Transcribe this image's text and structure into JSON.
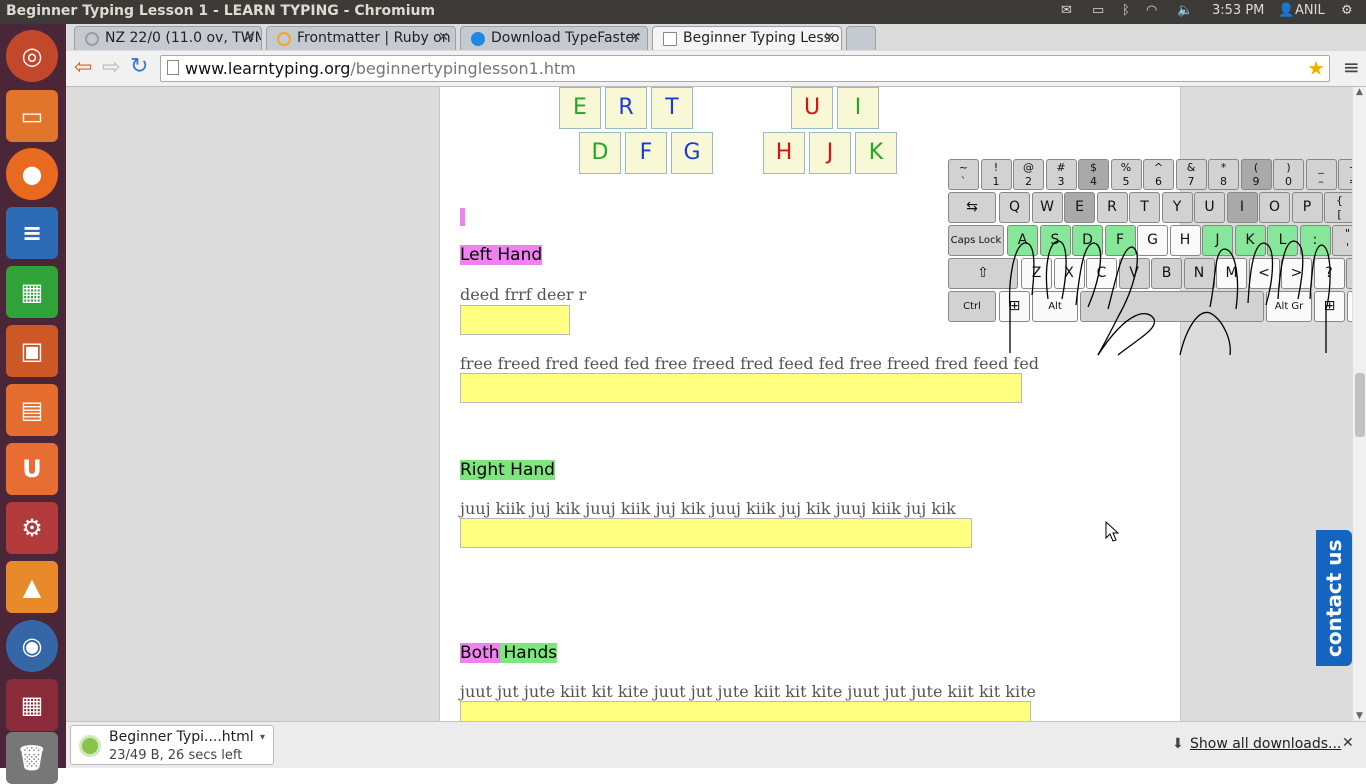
{
  "system": {
    "window_title": "Beginner Typing Lesson 1 - LEARN TYPING - Chromium",
    "time": "3:53 PM",
    "user": "ANIL"
  },
  "tabs": [
    {
      "label": "NZ 22/0 (11.0 ov, TWM",
      "fav_color": "#9e9e9e"
    },
    {
      "label": "Frontmatter | Ruby on",
      "fav_color": "#f5a623"
    },
    {
      "label": "Download TypeFaster",
      "fav_color": "#1e88e5"
    },
    {
      "label": "Beginner Typing Lesso",
      "fav_color": "#ffffff",
      "active": true
    }
  ],
  "address": {
    "domain": "www.learntyping.org",
    "path": "/beginnertypinglesson1.htm"
  },
  "letter_keys": {
    "row1": [
      "E",
      "R",
      "T",
      "U",
      "I"
    ],
    "row2": [
      "D",
      "F",
      "G",
      "H",
      "J",
      "K"
    ]
  },
  "keyboard": {
    "row1": [
      {
        "top": "~",
        "bot": "`"
      },
      {
        "top": "!",
        "bot": "1"
      },
      {
        "top": "@",
        "bot": "2"
      },
      {
        "top": "#",
        "bot": "3"
      },
      {
        "top": "$",
        "bot": "4"
      },
      {
        "top": "%",
        "bot": "5"
      },
      {
        "top": "^",
        "bot": "6"
      },
      {
        "top": "&",
        "bot": "7"
      },
      {
        "top": "*",
        "bot": "8"
      },
      {
        "top": "(",
        "bot": "9"
      },
      {
        "top": ")",
        "bot": "0"
      },
      {
        "top": "_",
        "bot": "–"
      },
      {
        "top": "+",
        "bot": "="
      }
    ],
    "row2": [
      "Q",
      "W",
      "E",
      "R",
      "T",
      "Y",
      "U",
      "I",
      "O",
      "P"
    ],
    "brackets": [
      {
        "top": "{",
        "bot": "["
      },
      {
        "top": "}",
        "bot": "]"
      }
    ],
    "row3": [
      "A",
      "S",
      "D",
      "F",
      "G",
      "H",
      "J",
      "K",
      "L",
      ":"
    ],
    "quote": {
      "top": "\"",
      "bot": "'"
    },
    "pipe": {
      "top": "|",
      "bot": "\\"
    },
    "row4": [
      "Z",
      "X",
      "C",
      "V",
      "B",
      "N",
      "M",
      "<",
      ">",
      "?"
    ],
    "capslock": "Caps Lock",
    "shift": "Shift",
    "ctrl": "Ctrl",
    "alt": "Alt",
    "altgr": "Alt Gr"
  },
  "lesson": {
    "left_hand_label": "Left Hand",
    "left_drill_1": "deed frrf deer r",
    "left_drill_2": "free freed fred feed fed free freed fred feed fed free freed fred feed fed",
    "right_hand_label": "Right Hand",
    "right_drill": "juuj kiik juj kik juuj kiik juj kik juuj kiik juj kik juuj kiik juj kik",
    "both_label_1": "Both",
    "both_label_2": "Hands",
    "both_drill": "juut jut jute kiit kit kite juut jut jute kiit kit kite juut jut jute kiit kit kite"
  },
  "contact": "contact us",
  "download": {
    "filename": "Beginner Typi....html",
    "status": "23/49 B, 26 secs left",
    "show_all": "Show all downloads..."
  },
  "colors": {
    "pink": "#ee82ee",
    "green": "#7de77d",
    "yellow": "#ffff80"
  }
}
